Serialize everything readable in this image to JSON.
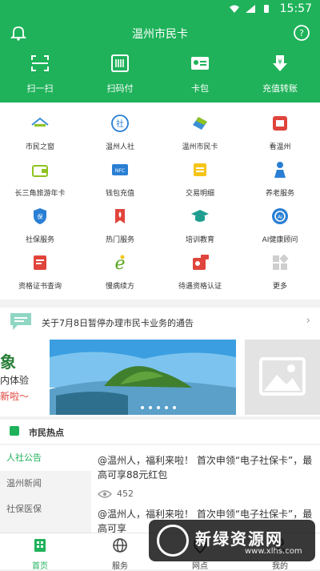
{
  "status_bar": {
    "time": "15:57"
  },
  "header": {
    "title": "温州市民卡",
    "quick_actions": [
      {
        "label": "扫一扫",
        "icon": "scan-icon"
      },
      {
        "label": "扫码付",
        "icon": "barcode-icon"
      },
      {
        "label": "卡包",
        "icon": "card-icon"
      },
      {
        "label": "充值转账",
        "icon": "yuan-down-icon"
      }
    ]
  },
  "grid": [
    {
      "label": "市民之窗",
      "icon": "window-icon"
    },
    {
      "label": "温州人社",
      "icon": "social-icon"
    },
    {
      "label": "温州市民卡",
      "icon": "citizen-card-icon"
    },
    {
      "label": "看温州",
      "icon": "watch-icon"
    },
    {
      "label": "长三角旅游年卡",
      "icon": "wallet-icon"
    },
    {
      "label": "钱包充值",
      "icon": "nfc-icon"
    },
    {
      "label": "交易明细",
      "icon": "transactions-icon"
    },
    {
      "label": "养老服务",
      "icon": "elderly-icon"
    },
    {
      "label": "社保服务",
      "icon": "shield-icon"
    },
    {
      "label": "热门服务",
      "icon": "fire-icon"
    },
    {
      "label": "培训教育",
      "icon": "graduation-icon"
    },
    {
      "label": "AI健康顾问",
      "icon": "ai-health-icon"
    },
    {
      "label": "资格证书查询",
      "icon": "certificate-icon"
    },
    {
      "label": "慢病续方",
      "icon": "chronic-icon"
    },
    {
      "label": "待遇资格认证",
      "icon": "verify-icon"
    },
    {
      "label": "更多",
      "icon": "more-icon"
    }
  ],
  "notice": {
    "text": "关于7月8日暂停办理市民卡业务的通告"
  },
  "banner": {
    "line1": "象",
    "line2": "内体验",
    "line3": "新啦～"
  },
  "hot_section": {
    "title": "市民热点"
  },
  "news": {
    "categories": [
      "人社公告",
      "温州新闻",
      "社保医保"
    ],
    "items": [
      {
        "text": "@温州人，福利来啦！ 首次申领“电子社保卡”，最高可享88元红包",
        "views": "452"
      },
      {
        "text": "@温州人，福利来啦！ 首次申领“电子社保卡”，最高可享"
      }
    ]
  },
  "tabbar": [
    {
      "label": "首页",
      "icon": "home-icon"
    },
    {
      "label": "服务",
      "icon": "globe-icon"
    },
    {
      "label": "网点",
      "icon": "location-icon"
    },
    {
      "label": "我的",
      "icon": "profile-icon"
    }
  ],
  "watermark": {
    "text": "新绿资源网",
    "url": "www.xlhs.com"
  },
  "colors": {
    "primary": "#1fb25a",
    "background": "#f2f2f2"
  }
}
